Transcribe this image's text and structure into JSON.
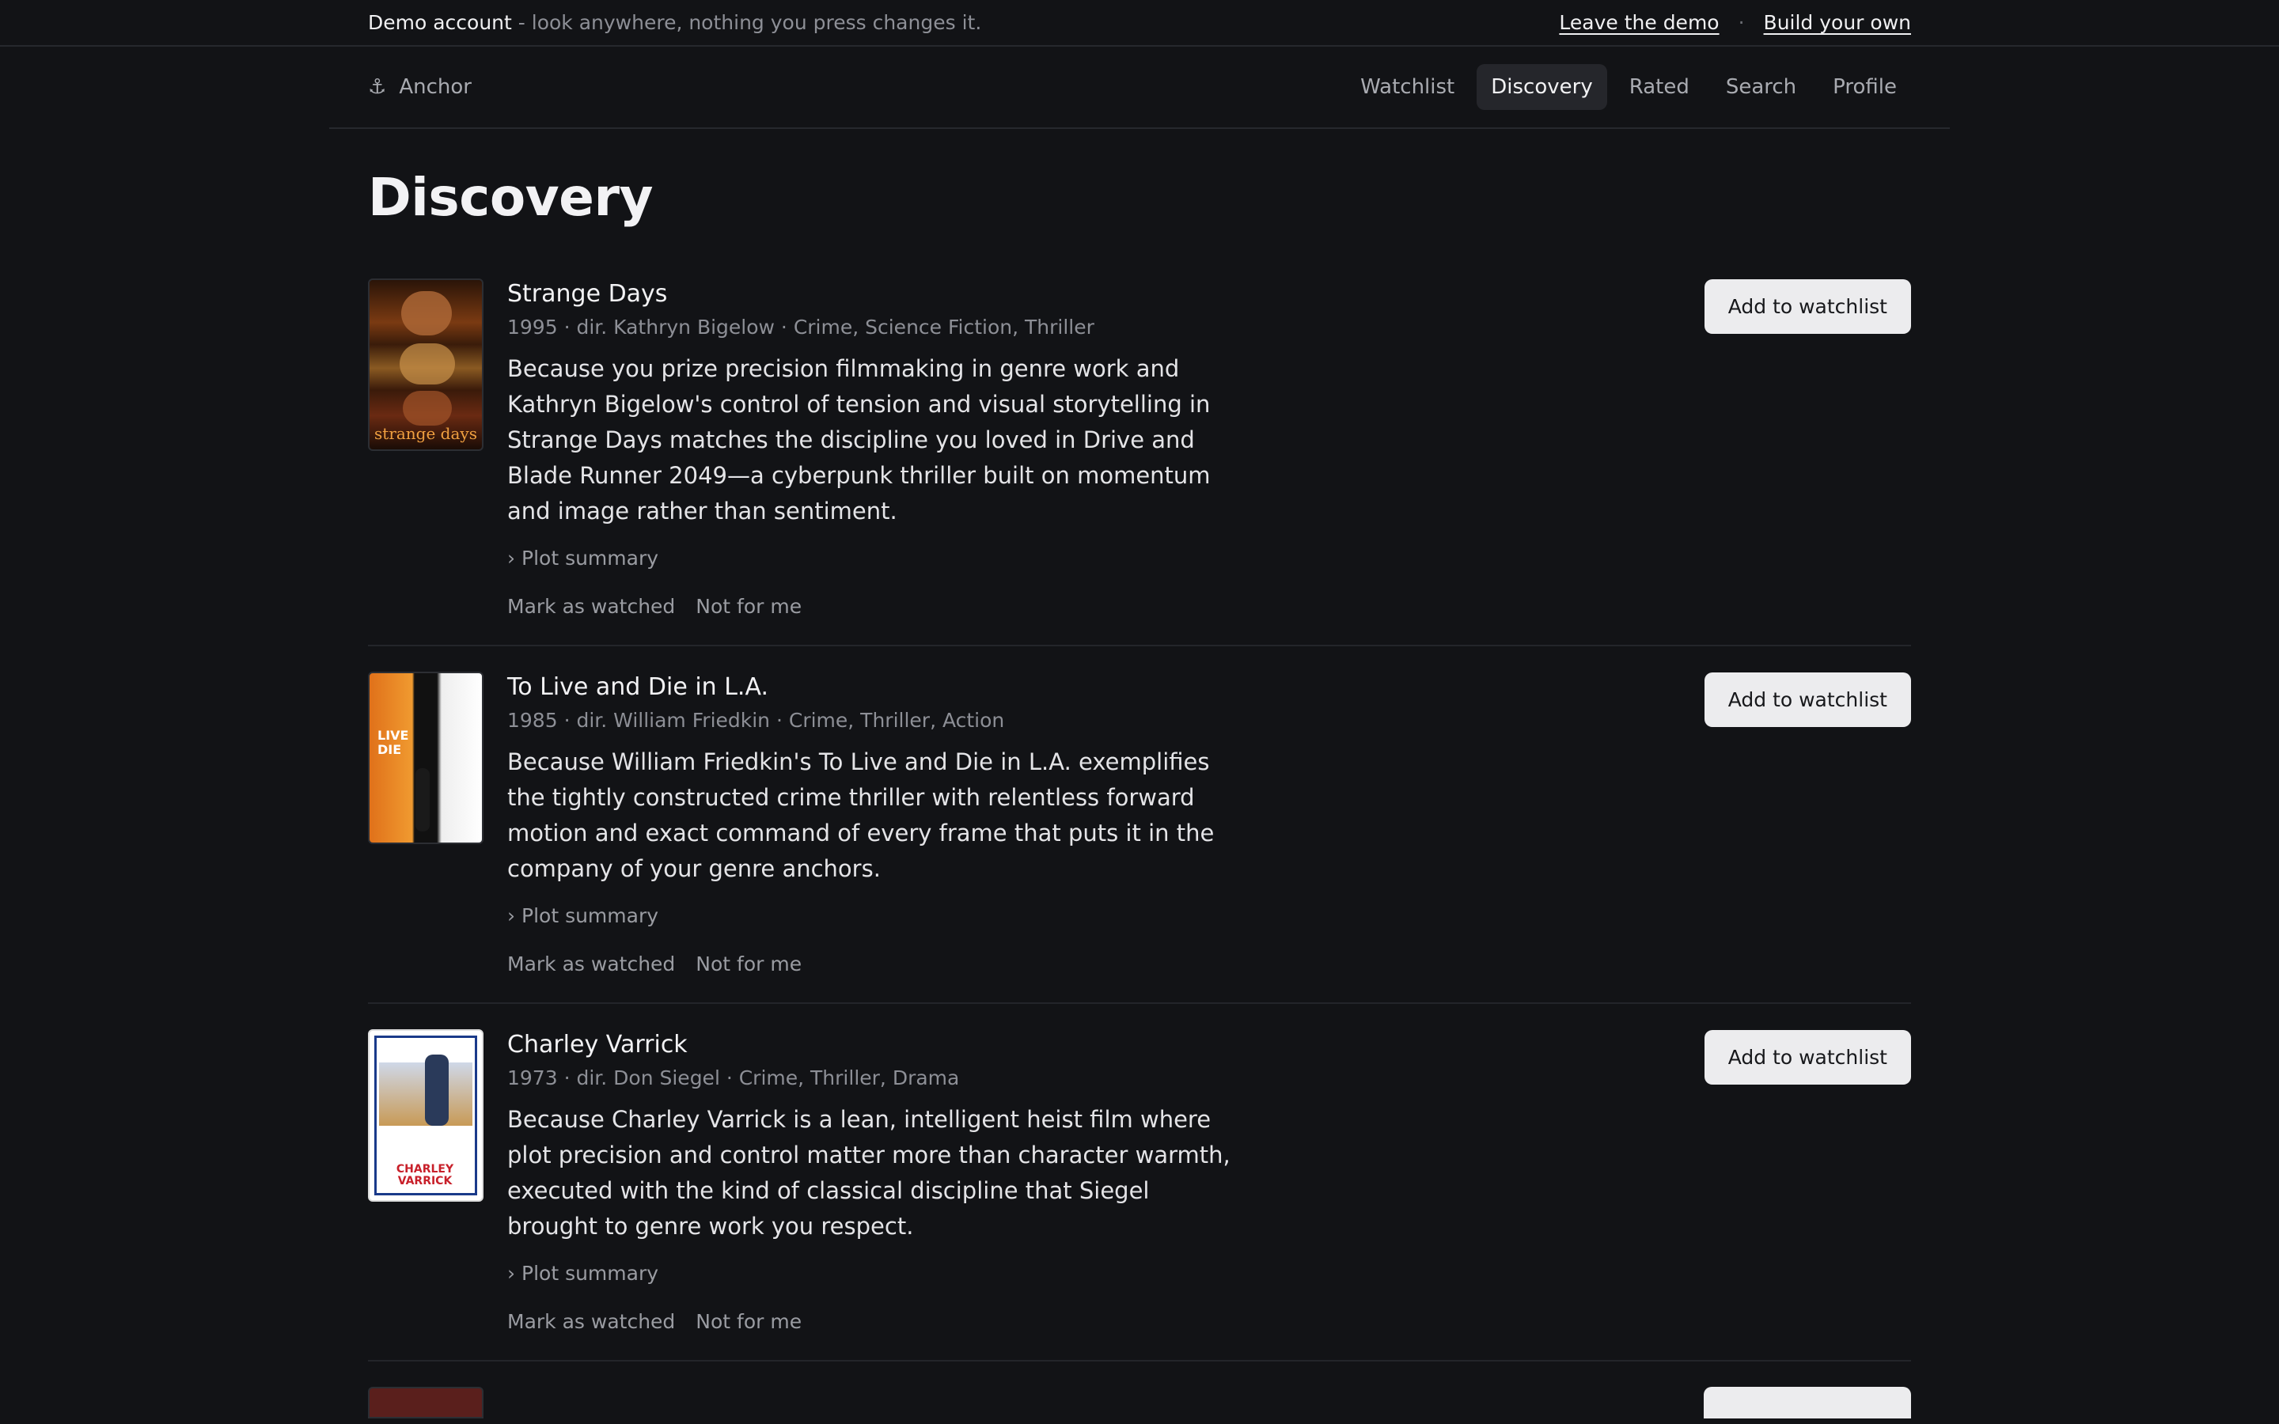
{
  "demo_bar": {
    "account_label": "Demo account",
    "note": " - look anywhere, nothing you press changes it.",
    "leave_link": "Leave the demo",
    "separator": "·",
    "build_link": "Build your own"
  },
  "nav": {
    "brand_icon": "⚓",
    "brand_name": "Anchor",
    "tabs": [
      {
        "label": "Watchlist",
        "active": false
      },
      {
        "label": "Discovery",
        "active": true
      },
      {
        "label": "Rated",
        "active": false
      },
      {
        "label": "Search",
        "active": false
      },
      {
        "label": "Profile",
        "active": false
      }
    ]
  },
  "page": {
    "title": "Discovery"
  },
  "films": [
    {
      "title": "Strange Days",
      "meta": "1995 · dir. Kathryn Bigelow · Crime, Science Fiction, Thriller",
      "reason": "Because you prize precision filmmaking in genre work and Kathryn Bigelow's control of tension and visual storytelling in Strange Days matches the discipline you loved in Drive and Blade Runner 2049—a cyberpunk thriller built on momentum and image rather than sentiment.",
      "summary_label": "Plot summary",
      "mark_watched": "Mark as watched",
      "not_for_me": "Not for me",
      "add_button": "Add to watchlist",
      "poster_text": "strange days"
    },
    {
      "title": "To Live and Die in L.A.",
      "meta": "1985 · dir. William Friedkin · Crime, Thriller, Action",
      "reason": "Because William Friedkin's To Live and Die in L.A. exemplifies the tightly constructed crime thriller with relentless forward motion and exact command of every frame that puts it in the company of your genre anchors.",
      "summary_label": "Plot summary",
      "mark_watched": "Mark as watched",
      "not_for_me": "Not for me",
      "add_button": "Add to watchlist",
      "poster_text": "LIVE DIE"
    },
    {
      "title": "Charley Varrick",
      "meta": "1973 · dir. Don Siegel · Crime, Thriller, Drama",
      "reason": "Because Charley Varrick is a lean, intelligent heist film where plot precision and control matter more than character warmth, executed with the kind of classical discipline that Siegel brought to genre work you respect.",
      "summary_label": "Plot summary",
      "mark_watched": "Mark as watched",
      "not_for_me": "Not for me",
      "add_button": "Add to watchlist",
      "poster_text": "CHARLEY VARRICK"
    }
  ],
  "colors": {
    "background": "#121316",
    "button": "#ececee",
    "active_tab": "#25262b"
  }
}
